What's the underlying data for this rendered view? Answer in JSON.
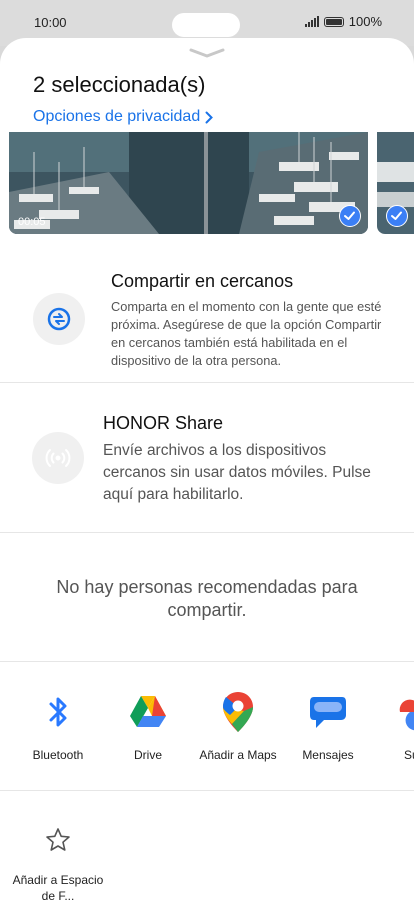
{
  "status_bar": {
    "time": "10:00",
    "battery": "100%"
  },
  "sheet": {
    "title": "2 seleccionada(s)",
    "privacy_link": "Opciones de privacidad",
    "thumbnails": [
      {
        "duration": "00:05",
        "selected": true
      },
      {
        "selected": true
      }
    ]
  },
  "nearby_share": {
    "icon": "nearby-share-icon",
    "title": "Compartir en cercanos",
    "description": "Comparta en el momento con la gente que esté próxima. Asegúrese de que la opción Compartir en cercanos también está habilitada en el dispositivo de la otra persona."
  },
  "honor_share": {
    "icon": "wireless-broadcast-icon",
    "title": "HONOR Share",
    "description": "Envíe archivos a los dispositivos cercanos sin usar datos móviles. Pulse aquí para habilitarlo."
  },
  "empty_message": "No hay personas recomendadas para compartir.",
  "apps": [
    {
      "label": "Bluetooth",
      "icon": "bluetooth-icon"
    },
    {
      "label": "Drive",
      "icon": "google-drive-icon"
    },
    {
      "label": "Añadir a Maps",
      "icon": "google-maps-icon"
    },
    {
      "label": "Mensajes",
      "icon": "messages-icon"
    },
    {
      "label": "Subir",
      "icon": "google-photos-icon"
    }
  ],
  "favorites": [
    {
      "label": "Añadir a Espacio de F...",
      "icon": "star-icon"
    }
  ],
  "colors": {
    "accent": "#1a73e8",
    "check": "#3b7ff5",
    "bluetooth": "#2979ff"
  }
}
